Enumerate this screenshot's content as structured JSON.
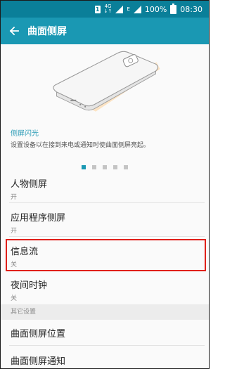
{
  "status_bar": {
    "sim": "1",
    "network": "4G",
    "network_sub": "↓↑",
    "data_type": "E",
    "battery": "100%",
    "time": "08:30"
  },
  "header": {
    "title": "曲面侧屏"
  },
  "hint": {
    "title": "侧屏闪光",
    "description": "设置设备以在接到来电或通知时使曲面侧屏亮起。"
  },
  "pager": {
    "total": 5,
    "active_index": 0
  },
  "settings": [
    {
      "title": "人物侧屏",
      "subtitle": "开"
    },
    {
      "title": "应用程序侧屏",
      "subtitle": "开"
    },
    {
      "title": "信息流",
      "subtitle": "关"
    },
    {
      "title": "夜间时钟",
      "subtitle": "关"
    }
  ],
  "other_section": {
    "header": "其它设置",
    "items": [
      {
        "title": "曲面侧屏位置"
      },
      {
        "title": "曲面侧屏通知"
      }
    ]
  },
  "colors": {
    "status_bar": "#0a7f99",
    "action_bar": "#1a98b3",
    "highlight": "#e0201a"
  }
}
